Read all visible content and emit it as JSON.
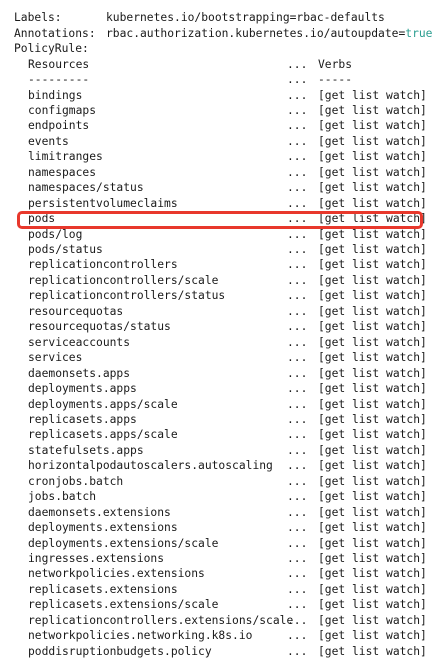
{
  "header": {
    "labels_key": "Labels:",
    "labels_value": "kubernetes.io/bootstrapping=rbac-defaults",
    "annotations_key": "Annotations:",
    "annotations_value_prefix": "rbac.authorization.kubernetes.io/autoupdate=",
    "annotations_value_flag": "true",
    "policyrule_key": "PolicyRule:"
  },
  "table": {
    "header": {
      "resources": "Resources",
      "dots": "...",
      "verbs": "Verbs"
    },
    "separator": {
      "resources": "---------",
      "dots": "...",
      "verbs": "-----"
    },
    "rows": [
      {
        "resource": "bindings",
        "dots": "...",
        "verbs": "[get list watch]"
      },
      {
        "resource": "configmaps",
        "dots": "...",
        "verbs": "[get list watch]"
      },
      {
        "resource": "endpoints",
        "dots": "...",
        "verbs": "[get list watch]"
      },
      {
        "resource": "events",
        "dots": "...",
        "verbs": "[get list watch]"
      },
      {
        "resource": "limitranges",
        "dots": "...",
        "verbs": "[get list watch]"
      },
      {
        "resource": "namespaces",
        "dots": "...",
        "verbs": "[get list watch]"
      },
      {
        "resource": "namespaces/status",
        "dots": "...",
        "verbs": "[get list watch]"
      },
      {
        "resource": "persistentvolumeclaims",
        "dots": "...",
        "verbs": "[get list watch]"
      },
      {
        "resource": "pods",
        "dots": "...",
        "verbs": "[get list watch]"
      },
      {
        "resource": "pods/log",
        "dots": "...",
        "verbs": "[get list watch]"
      },
      {
        "resource": "pods/status",
        "dots": "...",
        "verbs": "[get list watch]"
      },
      {
        "resource": "replicationcontrollers",
        "dots": "...",
        "verbs": "[get list watch]"
      },
      {
        "resource": "replicationcontrollers/scale",
        "dots": "...",
        "verbs": "[get list watch]"
      },
      {
        "resource": "replicationcontrollers/status",
        "dots": "...",
        "verbs": "[get list watch]"
      },
      {
        "resource": "resourcequotas",
        "dots": "...",
        "verbs": "[get list watch]"
      },
      {
        "resource": "resourcequotas/status",
        "dots": "...",
        "verbs": "[get list watch]"
      },
      {
        "resource": "serviceaccounts",
        "dots": "...",
        "verbs": "[get list watch]"
      },
      {
        "resource": "services",
        "dots": "...",
        "verbs": "[get list watch]"
      },
      {
        "resource": "daemonsets.apps",
        "dots": "...",
        "verbs": "[get list watch]"
      },
      {
        "resource": "deployments.apps",
        "dots": "...",
        "verbs": "[get list watch]"
      },
      {
        "resource": "deployments.apps/scale",
        "dots": "...",
        "verbs": "[get list watch]"
      },
      {
        "resource": "replicasets.apps",
        "dots": "...",
        "verbs": "[get list watch]"
      },
      {
        "resource": "replicasets.apps/scale",
        "dots": "...",
        "verbs": "[get list watch]"
      },
      {
        "resource": "statefulsets.apps",
        "dots": "...",
        "verbs": "[get list watch]"
      },
      {
        "resource": "horizontalpodautoscalers.autoscaling",
        "dots": "...",
        "verbs": "[get list watch]"
      },
      {
        "resource": "cronjobs.batch",
        "dots": "...",
        "verbs": "[get list watch]"
      },
      {
        "resource": "jobs.batch",
        "dots": "...",
        "verbs": "[get list watch]"
      },
      {
        "resource": "daemonsets.extensions",
        "dots": "...",
        "verbs": "[get list watch]"
      },
      {
        "resource": "deployments.extensions",
        "dots": "...",
        "verbs": "[get list watch]"
      },
      {
        "resource": "deployments.extensions/scale",
        "dots": "...",
        "verbs": "[get list watch]"
      },
      {
        "resource": "ingresses.extensions",
        "dots": "...",
        "verbs": "[get list watch]"
      },
      {
        "resource": "networkpolicies.extensions",
        "dots": "...",
        "verbs": "[get list watch]"
      },
      {
        "resource": "replicasets.extensions",
        "dots": "...",
        "verbs": "[get list watch]"
      },
      {
        "resource": "replicasets.extensions/scale",
        "dots": "...",
        "verbs": "[get list watch]"
      },
      {
        "resource": "replicationcontrollers.extensions/scale",
        "dots": "...",
        "verbs": "[get list watch]"
      },
      {
        "resource": "networkpolicies.networking.k8s.io",
        "dots": "...",
        "verbs": "[get list watch]"
      },
      {
        "resource": "poddisruptionbudgets.policy",
        "dots": "...",
        "verbs": "[get list watch]"
      }
    ]
  },
  "highlight": {
    "resource": "pods",
    "color": "#e8382c"
  },
  "colors": {
    "text": "#1a1a1a",
    "accent": "#2a9d8f",
    "background": "#ffffff"
  }
}
